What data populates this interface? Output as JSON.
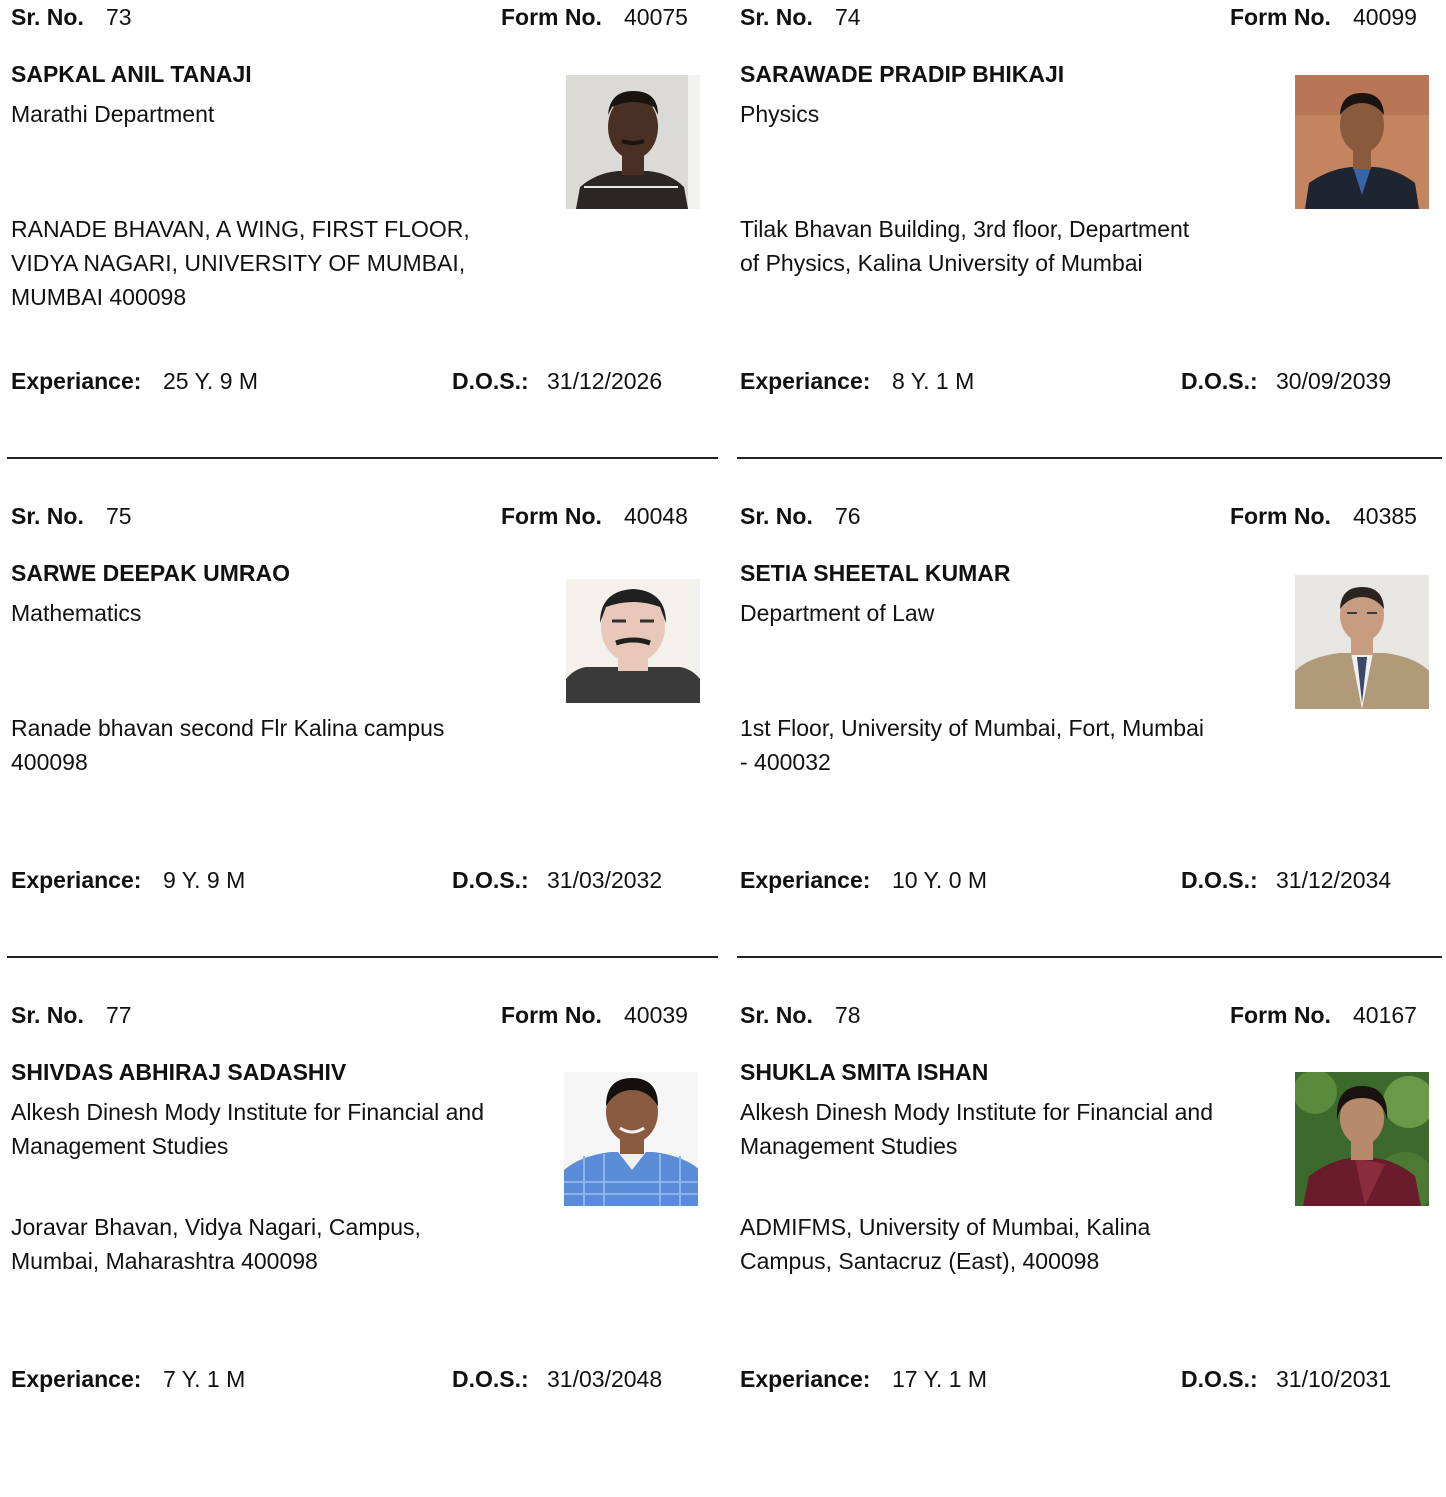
{
  "labels": {
    "sr_no": "Sr. No.",
    "form_no": "Form No.",
    "experience": "Experiance:",
    "dos": "D.O.S.:"
  },
  "cards": [
    {
      "sr_no": "73",
      "form_no": "40075",
      "name": "SAPKAL ANIL TANAJI",
      "department": "Marathi Department",
      "address_lines": [
        "RANADE BHAVAN, A WING, FIRST FLOOR,",
        "VIDYA NAGARI, UNIVERSITY OF MUMBAI,",
        "MUMBAI 400098"
      ],
      "experience": "25 Y. 9 M",
      "dos": "31/12/2026",
      "photo_colors": {
        "bg": "#dcdad6",
        "skin": "#4a3024",
        "shirt": "#2a2622"
      }
    },
    {
      "sr_no": "74",
      "form_no": "40099",
      "name": "SARAWADE PRADIP BHIKAJI",
      "department": "Physics",
      "address_lines": [
        "Tilak Bhavan Building, 3rd floor, Department",
        "of Physics, Kalina University of Mumbai"
      ],
      "experience": "8 Y. 1 M",
      "dos": "30/09/2039",
      "photo_colors": {
        "bg": "#c48460",
        "skin": "#8a5a3c",
        "shirt": "#1e2430"
      }
    },
    {
      "sr_no": "75",
      "form_no": "40048",
      "name": "SARWE DEEPAK UMRAO",
      "department": "Mathematics",
      "address_lines": [
        "Ranade bhavan second Flr Kalina campus",
        "400098"
      ],
      "experience": "9 Y. 9 M",
      "dos": "31/03/2032",
      "photo_colors": {
        "bg": "#f4f0ec",
        "skin": "#e8c8b8",
        "shirt": "#3a3a3a"
      }
    },
    {
      "sr_no": "76",
      "form_no": "40385",
      "name": "SETIA SHEETAL KUMAR",
      "department": "Department of Law",
      "address_lines": [
        "1st Floor, University of Mumbai, Fort, Mumbai",
        "- 400032"
      ],
      "experience": "10 Y. 0 M",
      "dos": "31/12/2034",
      "photo_colors": {
        "bg": "#e8e6e2",
        "skin": "#c89c80",
        "shirt": "#b09a78"
      }
    },
    {
      "sr_no": "77",
      "form_no": "40039",
      "name": "SHIVDAS ABHIRAJ SADASHIV",
      "department": "Alkesh Dinesh Mody Institute for Financial and Management Studies",
      "address_lines": [
        "Joravar Bhavan, Vidya Nagari, Campus,",
        "Mumbai, Maharashtra 400098"
      ],
      "experience": "7 Y. 1 M",
      "dos": "31/03/2048",
      "photo_colors": {
        "bg": "#f6f6f6",
        "skin": "#8a5a40",
        "shirt": "#5a8cd8"
      }
    },
    {
      "sr_no": "78",
      "form_no": "40167",
      "name": "SHUKLA SMITA ISHAN",
      "department": "Alkesh Dinesh Mody Institute for Financial and Management Studies",
      "address_lines": [
        "ADMIFMS, University of Mumbai, Kalina",
        "Campus, Santacruz (East), 400098"
      ],
      "experience": "17 Y. 1 M",
      "dos": "31/10/2031",
      "photo_colors": {
        "bg": "#3c6a2c",
        "skin": "#b88a6c",
        "shirt": "#6a1c2c"
      }
    }
  ]
}
